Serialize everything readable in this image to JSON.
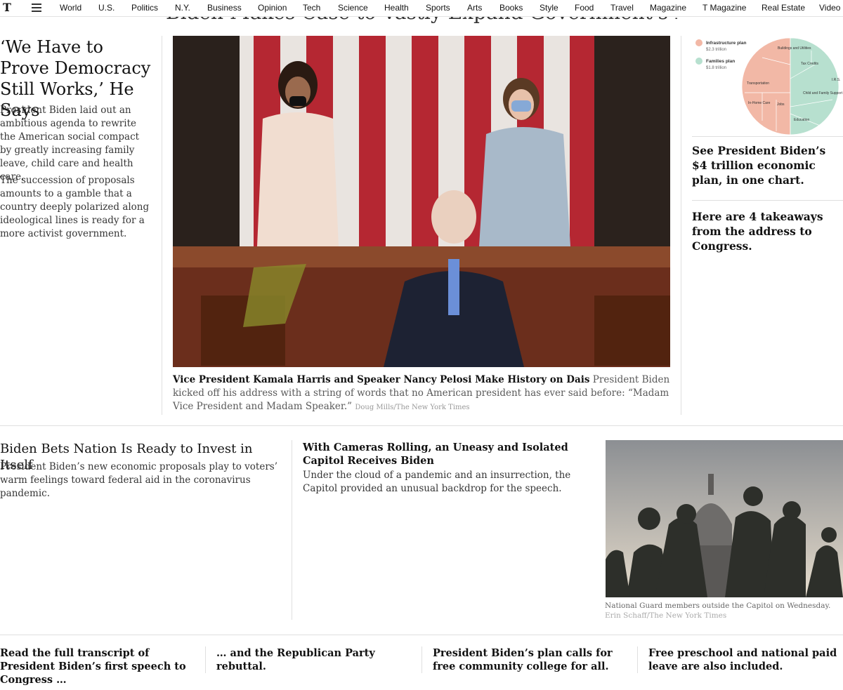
{
  "nav": {
    "logo": "T",
    "items": [
      "World",
      "U.S.",
      "Politics",
      "N.Y.",
      "Business",
      "Opinion",
      "Tech",
      "Science",
      "Health",
      "Sports",
      "Arts",
      "Books",
      "Style",
      "Food",
      "Travel",
      "Magazine",
      "T Magazine",
      "Real Estate",
      "Video"
    ]
  },
  "top_headline_partial": "Biden Makes Case to Vastly Expand Government's Role",
  "lede": {
    "title": "‘We Have to Prove Democracy Still Works,’ He Says",
    "summary1": "President Biden laid out an ambitious agenda to rewrite the American social compact by greatly increasing family leave, child care and health care.",
    "summary2": "The succession of proposals amounts to a gamble that a country deeply polarized along ideological lines is ready for a more activist government."
  },
  "main_caption": {
    "headline": "Vice President Kamala Harris and Speaker Nancy Pelosi Make History on Dais",
    "text": "President Biden kicked off his address with a string of words that no American president has ever said before: “Madam Vice President and Madam Speaker.”",
    "credit": "Doug Mills/The New York Times"
  },
  "chart": {
    "legend": [
      {
        "label": "Infrastructure plan",
        "amount": "$2.3 trillion",
        "color": "#f2b8a6"
      },
      {
        "label": "Families plan",
        "amount": "$1.8 trillion",
        "color": "#b7e0cf"
      }
    ],
    "segments": [
      "Buildings and Utilities",
      "Tax Credits",
      "I.R.S.",
      "Transportation",
      "Child and Family Support",
      "In-Home Care",
      "Jobs",
      "Education"
    ]
  },
  "right_links": {
    "link1": "See President Biden’s $4 trillion economic plan, in one chart.",
    "link2": "Here are 4 takeaways from the address to Congress."
  },
  "story2": {
    "headline": "Biden Bets Nation Is Ready to Invest in Itself",
    "summary": "President Biden’s new economic proposals play to voters’ warm feelings toward federal aid in the coronavirus pandemic."
  },
  "story3": {
    "headline": "With Cameras Rolling, an Uneasy and Isolated Capitol Receives Biden",
    "summary": "Under the cloud of a pandemic and an insurrection, the Capitol provided an unusual backdrop for the speech."
  },
  "guard_caption": {
    "text": "National Guard members outside the Capitol on Wednesday.",
    "credit": "Erin Schaff/The New York Times"
  },
  "bottom_links": [
    "Read the full transcript of President Biden’s first speech to Congress …",
    "… and the Republican Party rebuttal.",
    "President Biden’s plan calls for free community college for all.",
    "Free preschool and national paid leave are also included."
  ]
}
